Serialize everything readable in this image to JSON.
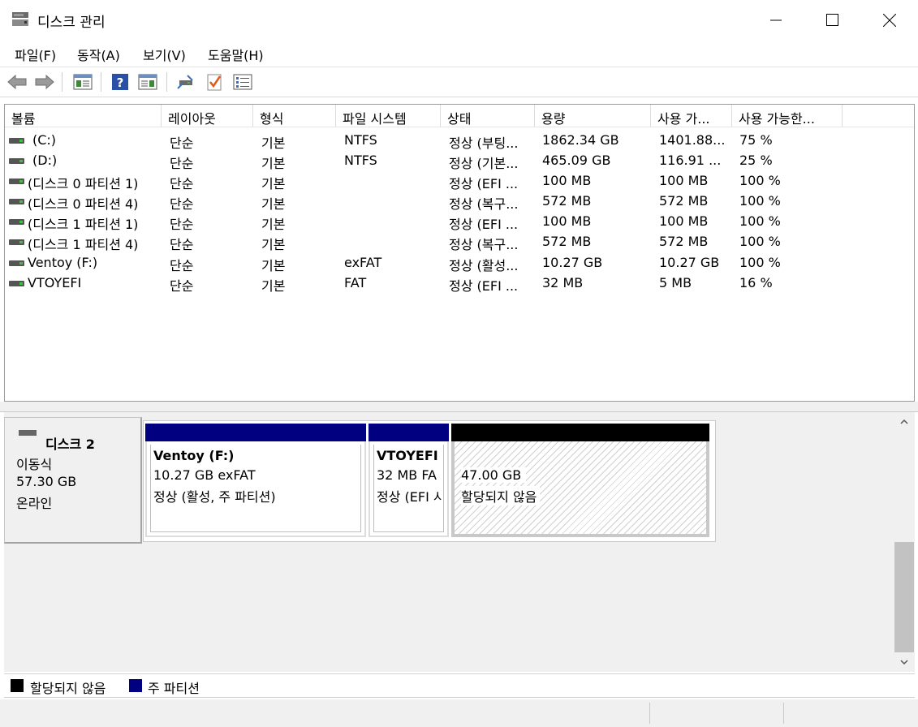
{
  "window": {
    "title": "디스크 관리"
  },
  "menu": [
    "파일(F)",
    "동작(A)",
    "보기(V)",
    "도움말(H)"
  ],
  "toolbar": {
    "buttons": [
      "back-arrow-icon",
      "forward-arrow-icon",
      "console-tree-icon",
      "help-icon",
      "properties-view-icon",
      "connect-icon",
      "check-icon",
      "list-icon"
    ]
  },
  "columns": [
    "볼륨",
    "레이아웃",
    "형식",
    "파일 시스템",
    "상태",
    "용량",
    "사용 가...",
    "사용 가능한..."
  ],
  "volumes": [
    {
      "name": "(C:)",
      "layout": "단순",
      "type": "기본",
      "fs": "NTFS",
      "status": "정상 (부팅...",
      "capacity": "1862.34 GB",
      "free": "1401.88...",
      "pct": "75 %"
    },
    {
      "name": "(D:)",
      "layout": "단순",
      "type": "기본",
      "fs": "NTFS",
      "status": "정상 (기본...",
      "capacity": "465.09 GB",
      "free": "116.91 ...",
      "pct": "25 %"
    },
    {
      "name": "(디스크 0 파티션 1)",
      "layout": "단순",
      "type": "기본",
      "fs": "",
      "status": "정상 (EFI ...",
      "capacity": "100 MB",
      "free": "100 MB",
      "pct": "100 %"
    },
    {
      "name": "(디스크 0 파티션 4)",
      "layout": "단순",
      "type": "기본",
      "fs": "",
      "status": "정상 (복구...",
      "capacity": "572 MB",
      "free": "572 MB",
      "pct": "100 %"
    },
    {
      "name": "(디스크 1 파티션 1)",
      "layout": "단순",
      "type": "기본",
      "fs": "",
      "status": "정상 (EFI ...",
      "capacity": "100 MB",
      "free": "100 MB",
      "pct": "100 %"
    },
    {
      "name": "(디스크 1 파티션 4)",
      "layout": "단순",
      "type": "기본",
      "fs": "",
      "status": "정상 (복구...",
      "capacity": "572 MB",
      "free": "572 MB",
      "pct": "100 %"
    },
    {
      "name": "Ventoy (F:)",
      "layout": "단순",
      "type": "기본",
      "fs": "exFAT",
      "status": "정상 (활성...",
      "capacity": "10.27 GB",
      "free": "10.27 GB",
      "pct": "100 %"
    },
    {
      "name": "VTOYEFI",
      "layout": "단순",
      "type": "기본",
      "fs": "FAT",
      "status": "정상 (EFI ...",
      "capacity": "32 MB",
      "free": "5 MB",
      "pct": "16 %"
    }
  ],
  "disk": {
    "name": "디스크 2",
    "kind": "이동식",
    "size": "57.30 GB",
    "state": "온라인",
    "partitions": [
      {
        "title": "Ventoy  (F:)",
        "line1": "10.27 GB exFAT",
        "line2": "정상 (활성, 주 파티션)",
        "bar_color": "#000080"
      },
      {
        "title": "VTOYEFI",
        "line1": "32 MB FA",
        "line2": "정상 (EFI 시",
        "bar_color": "#000080"
      },
      {
        "title": "",
        "line1": "47.00 GB",
        "line2": "할당되지 않음",
        "bar_color": "#000000"
      }
    ]
  },
  "legend": [
    {
      "label": "할당되지 않음",
      "color": "#000000"
    },
    {
      "label": "주 파티션",
      "color": "#000080"
    }
  ]
}
